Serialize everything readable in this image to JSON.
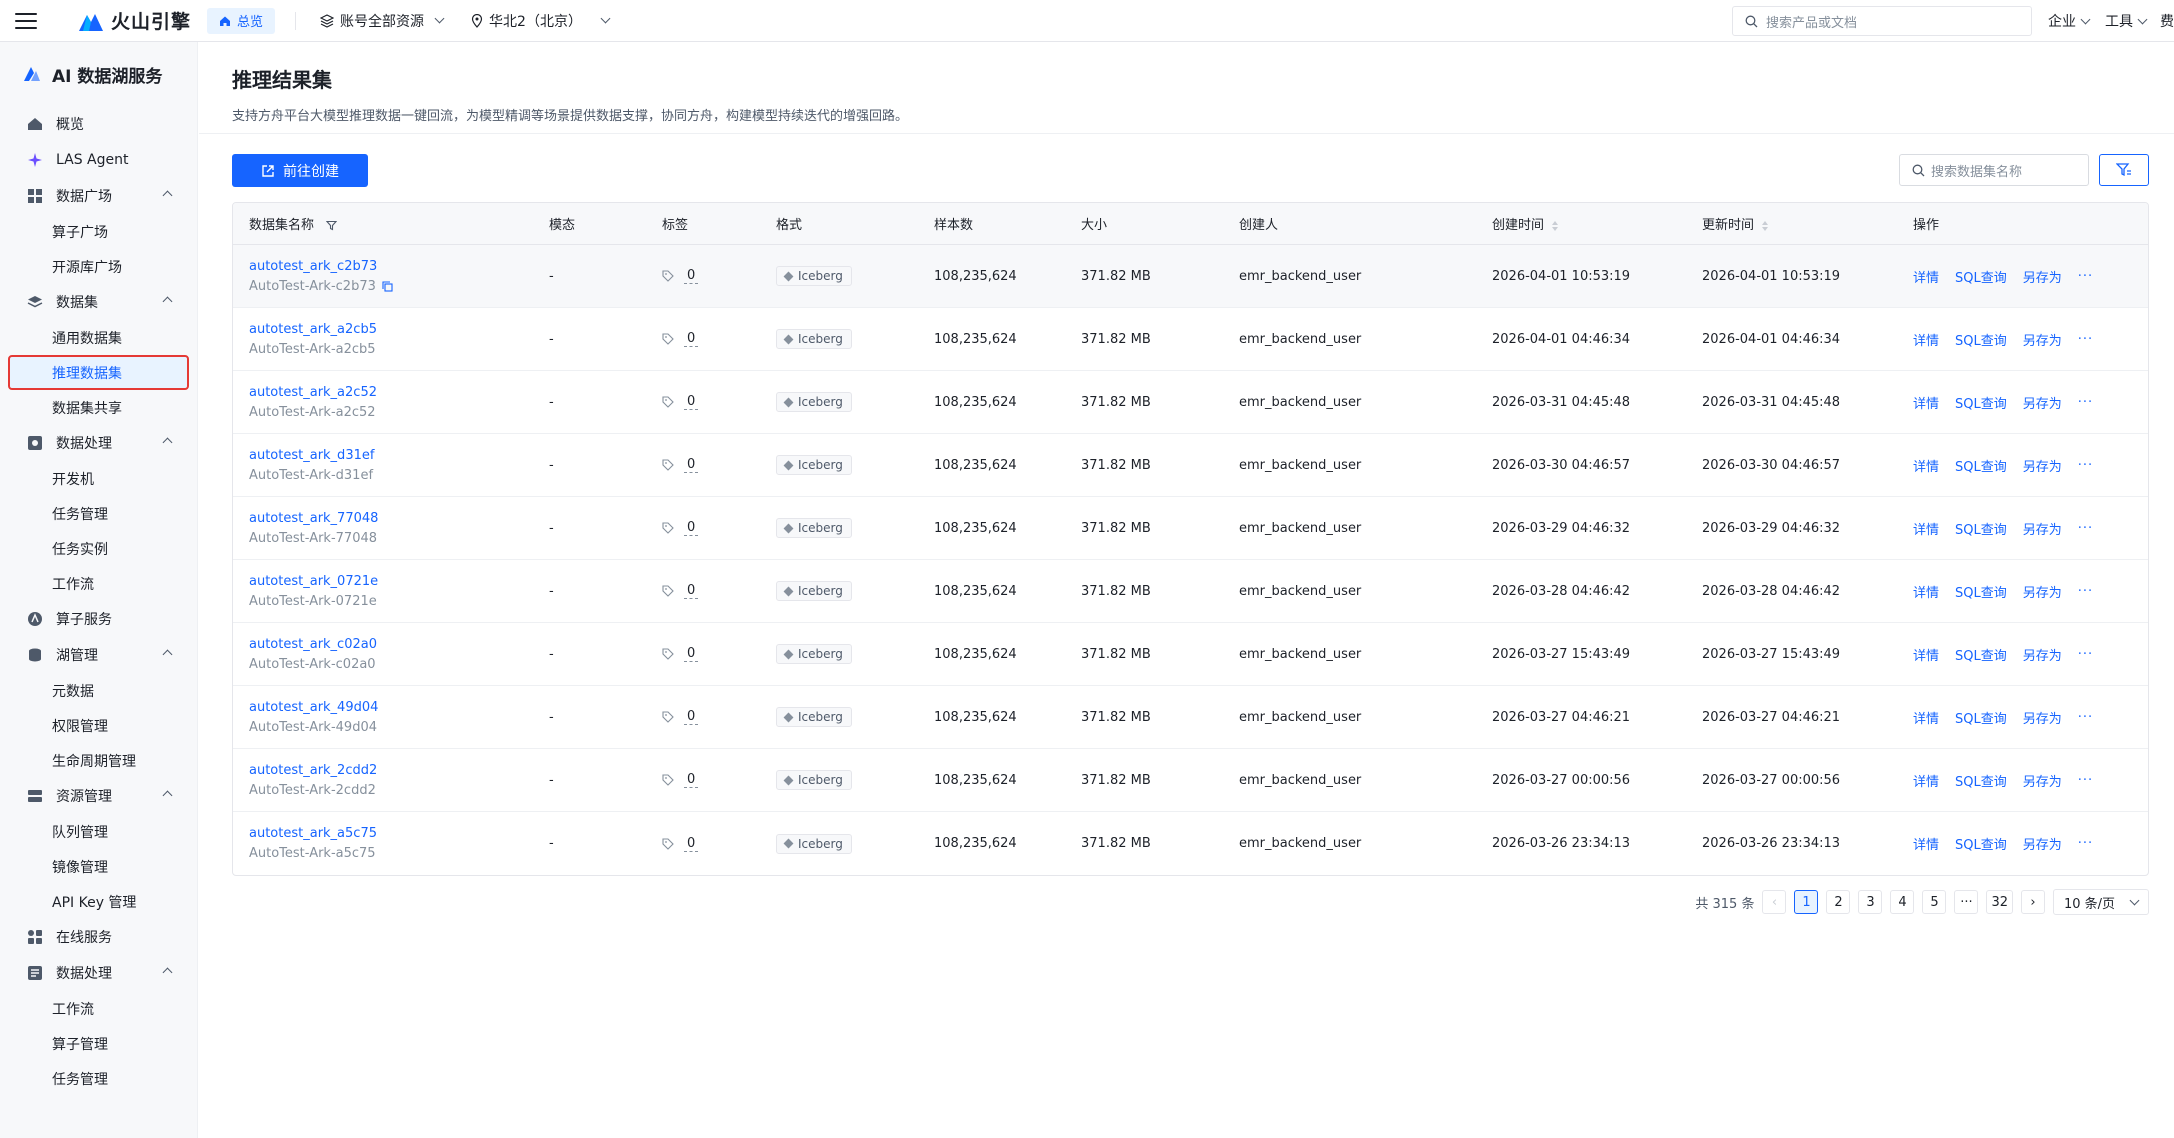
{
  "topbar": {
    "brand": "火山引擎",
    "home": "总览",
    "account_scope": "账号全部资源",
    "region": "华北2（北京）",
    "search_placeholder": "搜索产品或文档",
    "enterprise": "企业",
    "tools": "工具",
    "cutoff": "费"
  },
  "sidebar": {
    "title": "AI 数据湖服务",
    "groups": [
      {
        "label": "概览",
        "icon": "home-icon"
      },
      {
        "label": "LAS Agent",
        "icon": "sparkle-icon"
      },
      {
        "label": "数据广场",
        "icon": "grid-icon",
        "items": [
          "算子广场",
          "开源库广场"
        ]
      },
      {
        "label": "数据集",
        "icon": "layers-icon",
        "items": [
          "通用数据集",
          "推理数据集",
          "数据集共享"
        ]
      },
      {
        "label": "数据处理",
        "icon": "process-icon",
        "items": [
          "开发机",
          "任务管理",
          "任务实例",
          "工作流"
        ]
      },
      {
        "label": "算子服务",
        "icon": "operator-icon"
      },
      {
        "label": "湖管理",
        "icon": "lake-icon",
        "items": [
          "元数据",
          "权限管理",
          "生命周期管理"
        ]
      },
      {
        "label": "资源管理",
        "icon": "resource-icon",
        "items": [
          "队列管理",
          "镜像管理",
          "API Key 管理"
        ]
      },
      {
        "label": "在线服务",
        "icon": "apps-icon"
      },
      {
        "label": "数据处理",
        "icon": "process2-icon",
        "items": [
          "工作流",
          "算子管理",
          "任务管理"
        ]
      }
    ],
    "active": "推理数据集"
  },
  "page": {
    "title": "推理结果集",
    "description": "支持方舟平台大模型推理数据一键回流，为模型精调等场景提供数据支撑，协同方舟，构建模型持续迭代的增强回路。",
    "create_button": "前往创建",
    "search_placeholder": "搜索数据集名称"
  },
  "table": {
    "headers": [
      "数据集名称",
      "模态",
      "标签",
      "格式",
      "样本数",
      "大小",
      "创建人",
      "创建时间",
      "更新时间",
      "操作"
    ],
    "op_labels": [
      "详情",
      "SQL查询",
      "另存为",
      "···"
    ],
    "rows": [
      {
        "name": "autotest_ark_c2b73",
        "alias": "AutoTest-Ark-c2b73",
        "modality": "-",
        "tags": "0",
        "format": "Iceberg",
        "samples": "108,235,624",
        "size": "371.82 MB",
        "creator": "emr_backend_user",
        "created": "2026-04-01 10:53:19",
        "updated": "2026-04-01 10:53:19"
      },
      {
        "name": "autotest_ark_a2cb5",
        "alias": "AutoTest-Ark-a2cb5",
        "modality": "-",
        "tags": "0",
        "format": "Iceberg",
        "samples": "108,235,624",
        "size": "371.82 MB",
        "creator": "emr_backend_user",
        "created": "2026-04-01 04:46:34",
        "updated": "2026-04-01 04:46:34"
      },
      {
        "name": "autotest_ark_a2c52",
        "alias": "AutoTest-Ark-a2c52",
        "modality": "-",
        "tags": "0",
        "format": "Iceberg",
        "samples": "108,235,624",
        "size": "371.82 MB",
        "creator": "emr_backend_user",
        "created": "2026-03-31 04:45:48",
        "updated": "2026-03-31 04:45:48"
      },
      {
        "name": "autotest_ark_d31ef",
        "alias": "AutoTest-Ark-d31ef",
        "modality": "-",
        "tags": "0",
        "format": "Iceberg",
        "samples": "108,235,624",
        "size": "371.82 MB",
        "creator": "emr_backend_user",
        "created": "2026-03-30 04:46:57",
        "updated": "2026-03-30 04:46:57"
      },
      {
        "name": "autotest_ark_77048",
        "alias": "AutoTest-Ark-77048",
        "modality": "-",
        "tags": "0",
        "format": "Iceberg",
        "samples": "108,235,624",
        "size": "371.82 MB",
        "creator": "emr_backend_user",
        "created": "2026-03-29 04:46:32",
        "updated": "2026-03-29 04:46:32"
      },
      {
        "name": "autotest_ark_0721e",
        "alias": "AutoTest-Ark-0721e",
        "modality": "-",
        "tags": "0",
        "format": "Iceberg",
        "samples": "108,235,624",
        "size": "371.82 MB",
        "creator": "emr_backend_user",
        "created": "2026-03-28 04:46:42",
        "updated": "2026-03-28 04:46:42"
      },
      {
        "name": "autotest_ark_c02a0",
        "alias": "AutoTest-Ark-c02a0",
        "modality": "-",
        "tags": "0",
        "format": "Iceberg",
        "samples": "108,235,624",
        "size": "371.82 MB",
        "creator": "emr_backend_user",
        "created": "2026-03-27 15:43:49",
        "updated": "2026-03-27 15:43:49"
      },
      {
        "name": "autotest_ark_49d04",
        "alias": "AutoTest-Ark-49d04",
        "modality": "-",
        "tags": "0",
        "format": "Iceberg",
        "samples": "108,235,624",
        "size": "371.82 MB",
        "creator": "emr_backend_user",
        "created": "2026-03-27 04:46:21",
        "updated": "2026-03-27 04:46:21"
      },
      {
        "name": "autotest_ark_2cdd2",
        "alias": "AutoTest-Ark-2cdd2",
        "modality": "-",
        "tags": "0",
        "format": "Iceberg",
        "samples": "108,235,624",
        "size": "371.82 MB",
        "creator": "emr_backend_user",
        "created": "2026-03-27 00:00:56",
        "updated": "2026-03-27 00:00:56"
      },
      {
        "name": "autotest_ark_a5c75",
        "alias": "AutoTest-Ark-a5c75",
        "modality": "-",
        "tags": "0",
        "format": "Iceberg",
        "samples": "108,235,624",
        "size": "371.82 MB",
        "creator": "emr_backend_user",
        "created": "2026-03-26 23:34:13",
        "updated": "2026-03-26 23:34:13"
      }
    ]
  },
  "pagination": {
    "total": "共 315 条",
    "pages": [
      "1",
      "2",
      "3",
      "4",
      "5",
      "···",
      "32"
    ],
    "current": "1",
    "page_size": "10 条/页"
  },
  "colors": {
    "accent": "#1664ff",
    "highlight_border": "#e53935",
    "sidebar_bg": "#f7f8fa"
  }
}
